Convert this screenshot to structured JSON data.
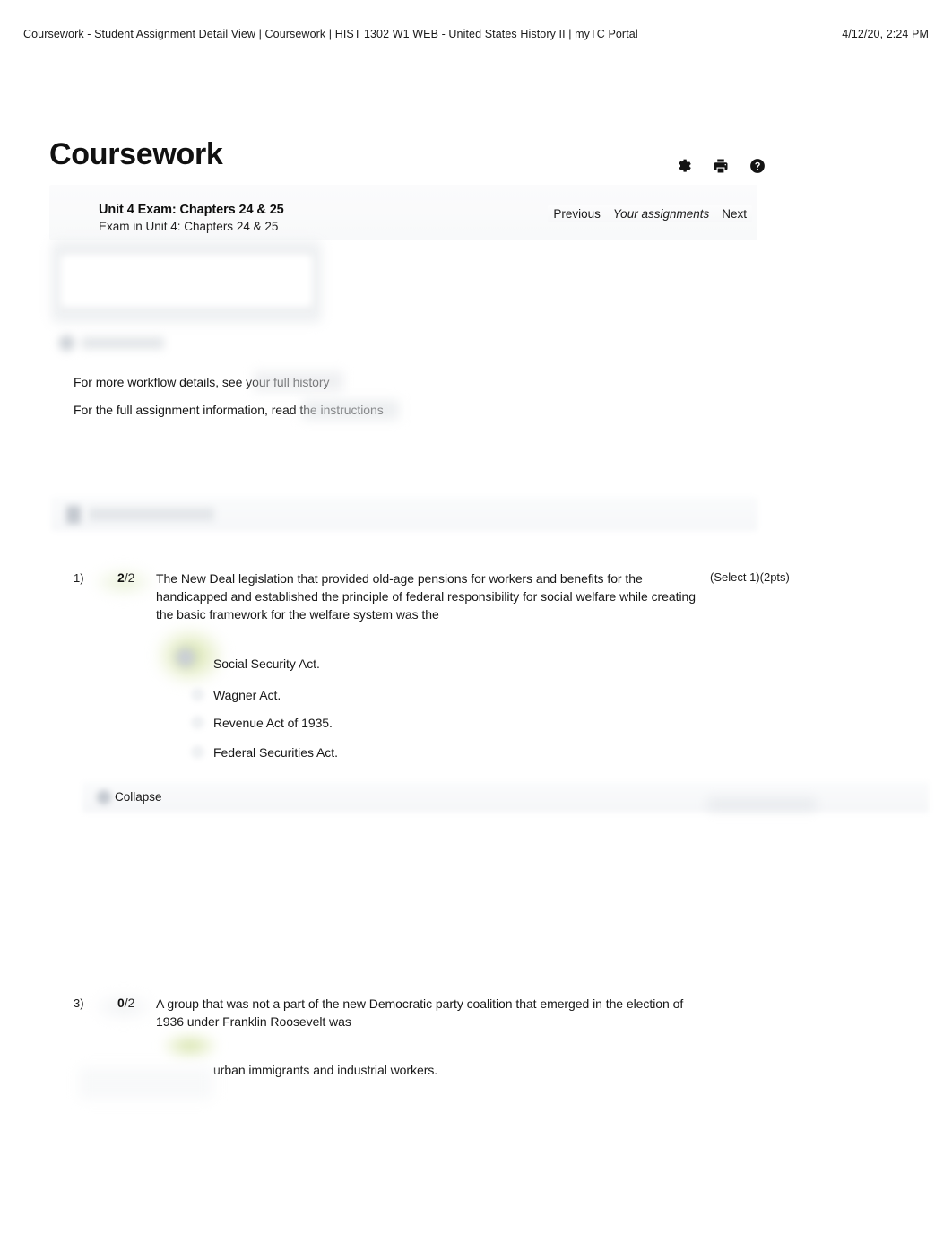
{
  "print_header": {
    "title": "Coursework - Student Assignment Detail View | Coursework | HIST 1302 W1 WEB - United States History II | myTC Portal",
    "datetime": "4/12/20, 2:24 PM"
  },
  "page": {
    "title": "Coursework"
  },
  "header_icons": [
    {
      "name": "settings-icon",
      "label": "Settings"
    },
    {
      "name": "print-icon",
      "label": "Print"
    },
    {
      "name": "help-icon",
      "label": "Help"
    }
  ],
  "assignment": {
    "title": "Unit 4 Exam: Chapters 24 & 25",
    "subtitle": "Exam in Unit 4: Chapters 24 & 25"
  },
  "pager": {
    "previous": "Previous",
    "current": "Your assignments",
    "next": "Next"
  },
  "info_lines": {
    "workflow": "For more workflow details, see your full history",
    "instructions": "For the full assignment information, read the instructions"
  },
  "collapse": {
    "label": "Collapse"
  },
  "questions": [
    {
      "number": "1)",
      "score_earned": "2",
      "score_total": "/2",
      "meta": "(Select 1)(2pts)",
      "text": "The New Deal legislation that provided old-age pensions for workers and benefits for the handicapped and established the principle of federal responsibility for social welfare while creating the basic framework for the welfare system was the",
      "options": [
        "Social Security Act.",
        "Wagner Act.",
        "Revenue Act of 1935.",
        "Federal Securities Act."
      ]
    },
    {
      "number": "3)",
      "score_earned": "0",
      "score_total": "/2",
      "meta": "",
      "text": "A group that was not a part of the new Democratic party coalition that emerged in the election of 1936 under Franklin Roosevelt was",
      "options": [
        "urban immigrants and industrial workers."
      ]
    }
  ],
  "colors": {
    "correct_highlight": "#cddd96",
    "band_background": "#f8f9fa",
    "text": "#171717"
  }
}
